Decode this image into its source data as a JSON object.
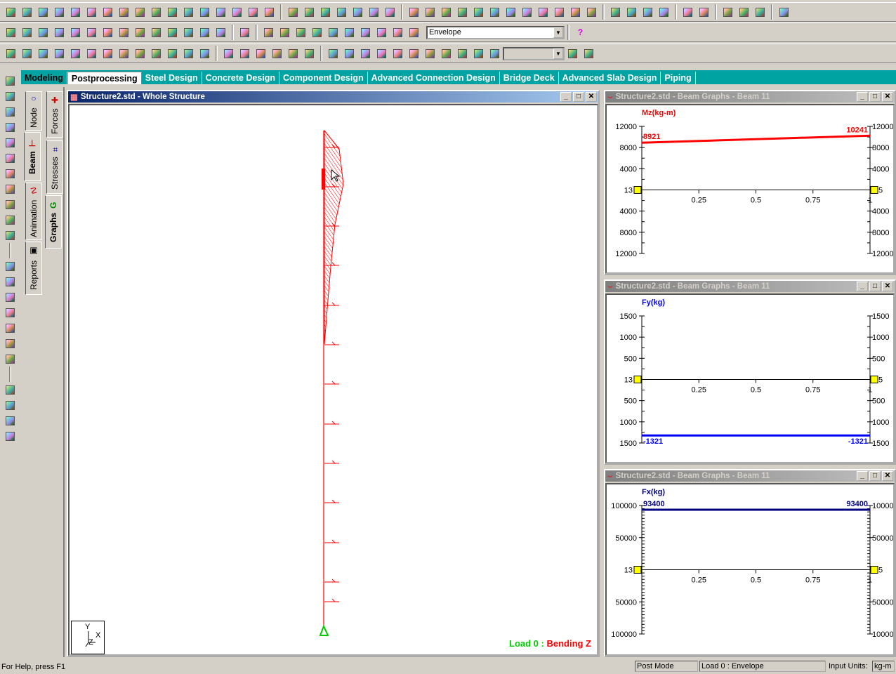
{
  "toolbars": {
    "row1": [
      "new-file-icon",
      "open-file-icon",
      "open-folder-icon",
      "save-icon",
      "copy-picture-icon",
      "cut-icon",
      "paste-icon",
      "delete-icon",
      "undo-icon",
      "undo-step-icon",
      "redo-icon",
      "redo-step-icon",
      "check-icon",
      "calculator-icon",
      "memo-icon",
      "run-analysis-icon",
      "hammer-icon",
      "|",
      "print-icon",
      "print-preview-icon",
      "print-current-icon",
      "camera-icon",
      "export-icon",
      "report-icon",
      "preview-report-icon",
      "|",
      "page-icon",
      "dimension-icon",
      "labels-icon",
      "distance-icon",
      "label-icon",
      "node-label-icon",
      "length-icon",
      "select-icon",
      "filter-icon",
      "help-icon",
      "annotate-icon",
      "annotate2-icon",
      "|",
      "rotate-icon",
      "rotate2-icon",
      "zoom-rotate-icon",
      "pan-icon",
      "|",
      "arc-icon",
      "diagram-icon",
      "|",
      "structure-icon",
      "symbols-icon",
      "refresh-icon",
      "|",
      "plug-icon"
    ],
    "row2": [
      "iso-view-1-icon",
      "iso-view-2-icon",
      "iso-view-3-icon",
      "iso-view-4-icon",
      "iso-view-5-icon",
      "iso-view-6-icon",
      "iso-view-7-icon",
      "front-view-icon",
      "back-view-icon",
      "left-view-icon",
      "right-view-icon",
      "top-view-icon",
      "bottom-view-icon",
      "select-view-icon",
      "|",
      "display-window-icon",
      "|",
      "zoom-in-icon",
      "zoom-window-icon",
      "zoom-dynamic-icon",
      "zoom-out-icon",
      "zoom-all-icon",
      "zoom-prev-icon",
      "zoom-fit-icon",
      "pan-view-icon",
      "magnify-icon",
      "shading-icon"
    ],
    "row3": [
      "beam-select-icon",
      "plate-select-icon",
      "node-select-icon",
      "solid-select-icon",
      "member-select-icon",
      "grid-select-icon",
      "table1-icon",
      "table2-icon",
      "table3-icon",
      "table4-icon",
      "support-icon",
      "sphere-icon",
      "table5-icon",
      "|",
      "cursor-icon",
      "cursor2-icon",
      "axes-icon",
      "refresh-view-icon",
      "grid-icon",
      "pointer-icon",
      "|",
      "fx-icon",
      "fy-icon",
      "fz-icon",
      "mx-icon",
      "my-icon",
      "mz-icon",
      "shape1-icon",
      "shape2-icon",
      "shape3-icon",
      "shape4-icon",
      "shape5-icon"
    ],
    "envelope_select": "Envelope",
    "help_icon": "help-icon",
    "row3_select": ""
  },
  "tabs": [
    "Modeling",
    "Postprocessing",
    "Steel Design",
    "Concrete Design",
    "Component Design",
    "Advanced Connection Design",
    "Bridge Deck",
    "Advanced Slab Design",
    "Piping"
  ],
  "active_tab": 1,
  "left_toolbar": [
    "select-nodes-icon",
    "select-pointer-icon",
    "select-beams-icon",
    "select-plates-icon",
    "select-solids-icon",
    "select-members-icon",
    "select-geometry-icon",
    "select-supports-icon",
    "select-loads-icon",
    "select-parallel-icon",
    "select-all-icon",
    "|",
    "graph1-icon",
    "graph2-icon",
    "graph3-icon",
    "graph4-icon",
    "graph5-icon",
    "graph6-icon",
    "graph7-icon",
    "|",
    "tool1-icon",
    "tool2-icon",
    "tool3-icon",
    "tool4-icon"
  ],
  "side_tabs": {
    "col1": [
      "Node",
      "Beam",
      "Animation",
      "Reports"
    ],
    "col2": [
      "Forces",
      "Stresses",
      "Graphs"
    ]
  },
  "main_window": {
    "title": "Structure2.std - Whole Structure",
    "load_label_green": "Load 0 : ",
    "load_label_red": "Bending Z",
    "axes": {
      "y": "Y",
      "x": "X",
      "z": "Z"
    }
  },
  "graph_windows": [
    {
      "title": "Structure2.std - Beam Graphs - Beam 11"
    },
    {
      "title": "Structure2.std - Beam Graphs - Beam 11"
    },
    {
      "title": "Structure2.std - Beam Graphs - Beam 11"
    }
  ],
  "chart_data": [
    {
      "type": "line",
      "title": "Mz(kg-m)",
      "color": "#ff0000",
      "x": [
        0,
        1
      ],
      "values": [
        8921,
        10241
      ],
      "ylim": [
        -12000,
        12000
      ],
      "yticks": [
        "12000",
        "8000",
        "4000",
        "",
        "4000",
        "8000",
        "12000"
      ],
      "ytick_values": [
        12000,
        8000,
        4000,
        0,
        -4000,
        -8000,
        -12000
      ],
      "xticks": [
        "0.25",
        "0.5",
        "0.75",
        "1"
      ],
      "start_node": "13",
      "end_node": "5",
      "labels": [
        "8921",
        "10241"
      ]
    },
    {
      "type": "line",
      "title": "Fy(kg)",
      "color": "#0000ff",
      "x": [
        0,
        1
      ],
      "values": [
        -1321,
        -1321
      ],
      "ylim": [
        -1500,
        1500
      ],
      "yticks": [
        "1500",
        "1000",
        "500",
        "",
        "500",
        "1000",
        "1500"
      ],
      "ytick_values": [
        1500,
        1000,
        500,
        0,
        -500,
        -1000,
        -1500
      ],
      "xticks": [
        "0.25",
        "0.5",
        "0.75",
        "1"
      ],
      "start_node": "13",
      "end_node": "5",
      "labels": [
        "-1321",
        "-1321"
      ]
    },
    {
      "type": "line",
      "title": "Fx(kg)",
      "color": "#000080",
      "x": [
        0,
        1
      ],
      "values": [
        93400,
        93400
      ],
      "ylim": [
        -100000,
        100000
      ],
      "yticks": [
        "100000",
        "50000",
        "",
        "50000",
        "100000"
      ],
      "ytick_values": [
        100000,
        50000,
        0,
        -50000,
        -100000
      ],
      "xticks": [
        "0.25",
        "0.5",
        "0.75",
        "1"
      ],
      "start_node": "13",
      "end_node": "5",
      "labels": [
        "93400",
        "93400"
      ]
    }
  ],
  "status": {
    "help": "For Help, press F1",
    "mode": "Post Mode",
    "load": "Load 0 : Envelope",
    "units_label": "Input Units:",
    "units": "kg-m"
  }
}
